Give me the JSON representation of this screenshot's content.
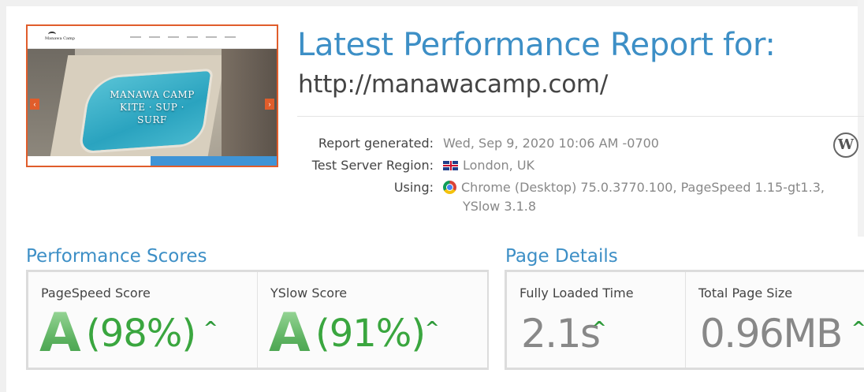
{
  "thumbnail": {
    "logo_text": "Manawa Camp",
    "hero_lines": [
      "MANAWA CAMP",
      "KITE · SUP ·",
      "SURF"
    ],
    "arrow_left": "‹",
    "arrow_right": "›"
  },
  "report": {
    "title": "Latest Performance Report for:",
    "url": "http://manawacamp.com/",
    "generated_label": "Report generated:",
    "generated_value": "Wed, Sep 9, 2020 10:06 AM -0700",
    "region_label": "Test Server Region:",
    "region_value": "London, UK",
    "using_label": "Using:",
    "using_value_line1": "Chrome (Desktop) 75.0.3770.100, PageSpeed 1.15-gt1.3,",
    "using_value_line2": "YSlow 3.1.8",
    "cms_icon": "wordpress-icon",
    "cms_glyph": "W"
  },
  "performance_scores": {
    "title": "Performance Scores",
    "pagespeed": {
      "label": "PageSpeed Score",
      "grade": "A",
      "percent": "(98%)",
      "trend": "^"
    },
    "yslow": {
      "label": "YSlow Score",
      "grade": "A",
      "percent": "(91%)",
      "trend": "^"
    }
  },
  "page_details": {
    "title": "Page Details",
    "load_time": {
      "label": "Fully Loaded Time",
      "value": "2.1s",
      "trend": "^"
    },
    "page_size": {
      "label": "Total Page Size",
      "value": "0.96MB",
      "trend": "^"
    }
  },
  "colors": {
    "accent_blue": "#3d8fc6",
    "grade_green": "#3aa63f",
    "thumb_border": "#e05d2b"
  }
}
